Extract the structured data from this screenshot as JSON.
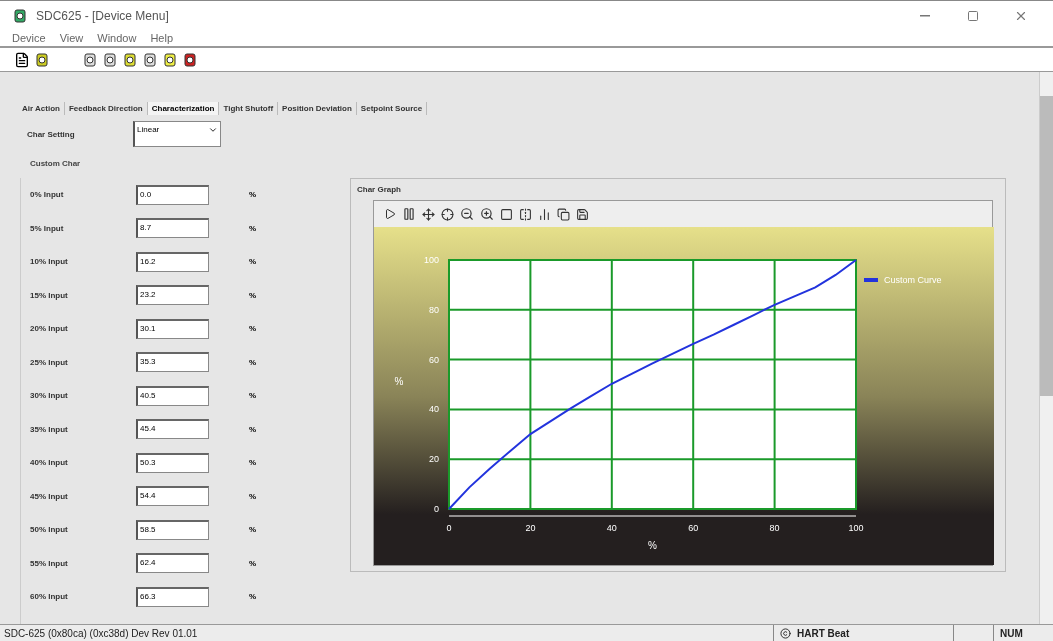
{
  "window": {
    "title": "SDC625 - [Device Menu]"
  },
  "menu": [
    "Device",
    "View",
    "Window",
    "Help"
  ],
  "tabs": [
    {
      "label": "Air Action",
      "selected": false
    },
    {
      "label": "Feedback Direction",
      "selected": false
    },
    {
      "label": "Characterization",
      "selected": true
    },
    {
      "label": "Tight Shutoff",
      "selected": false
    },
    {
      "label": "Position Deviation",
      "selected": false
    },
    {
      "label": "Setpoint Source",
      "selected": false
    }
  ],
  "char_setting": {
    "label": "Char Setting",
    "value": "Linear"
  },
  "custom_char": {
    "title": "Custom Char",
    "unit": "%",
    "rows": [
      {
        "label": "0% Input",
        "value": "0.0"
      },
      {
        "label": "5% Input",
        "value": "8.7"
      },
      {
        "label": "10% Input",
        "value": "16.2"
      },
      {
        "label": "15% Input",
        "value": "23.2"
      },
      {
        "label": "20% Input",
        "value": "30.1"
      },
      {
        "label": "25% Input",
        "value": "35.3"
      },
      {
        "label": "30% Input",
        "value": "40.5"
      },
      {
        "label": "35% Input",
        "value": "45.4"
      },
      {
        "label": "40% Input",
        "value": "50.3"
      },
      {
        "label": "45% Input",
        "value": "54.4"
      },
      {
        "label": "50% Input",
        "value": "58.5"
      },
      {
        "label": "55% Input",
        "value": "62.4"
      },
      {
        "label": "60% Input",
        "value": "66.3"
      }
    ]
  },
  "char_graph": {
    "title": "Char Graph",
    "chart_data": {
      "type": "line",
      "xlabel": "%",
      "ylabel": "%",
      "x": [
        0,
        5,
        10,
        15,
        20,
        25,
        30,
        35,
        40,
        45,
        50,
        55,
        60,
        65,
        70,
        75,
        80,
        85,
        90,
        95,
        100
      ],
      "series": [
        {
          "name": "Custom Curve",
          "color": "#2233dd",
          "values": [
            0,
            8.7,
            16.2,
            23.2,
            30.1,
            35.3,
            40.5,
            45.4,
            50.3,
            54.4,
            58.5,
            62.4,
            66.3,
            70,
            74,
            78,
            82,
            85.5,
            89,
            94,
            100
          ]
        }
      ],
      "xlim": [
        0,
        100
      ],
      "ylim": [
        0,
        100
      ],
      "xticks": [
        0,
        20,
        40,
        60,
        80,
        100
      ],
      "yticks": [
        0,
        20,
        40,
        60,
        80,
        100
      ],
      "grid": true
    }
  },
  "status_bar": {
    "device": "SDC-625   (0x80ca) (0xc38d) Dev Rev 01.01",
    "heartbeat": "HART Beat",
    "num": "NUM"
  }
}
